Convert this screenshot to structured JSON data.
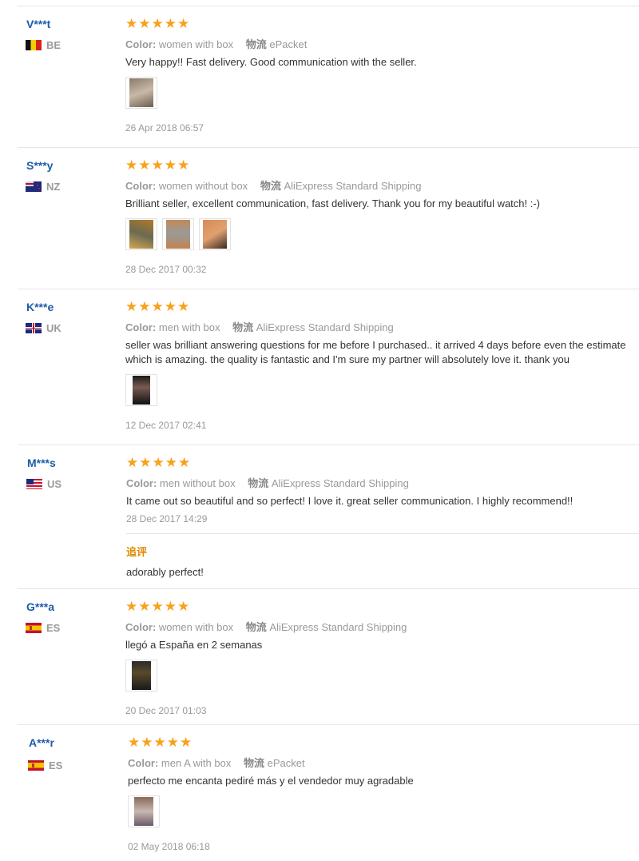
{
  "labels": {
    "color": "Color:",
    "shipping": "物流",
    "followup": "追评"
  },
  "reviews": [
    {
      "user": "V***t",
      "country": "BE",
      "stars": 5,
      "color": "women with box",
      "shipping": "ePacket",
      "text": [
        "Very happy!! Fast delivery. Good communication with the seller."
      ],
      "photos": 1,
      "date": "26 Apr 2018 06:57"
    },
    {
      "user": "S***y",
      "country": "NZ",
      "stars": 5,
      "color": "women without box",
      "shipping": "AliExpress Standard Shipping",
      "text": [
        "Brilliant seller, excellent communication, fast delivery. Thank you for my beautiful watch! :-)"
      ],
      "photos": 3,
      "date": "28 Dec 2017 00:32"
    },
    {
      "user": "K***e",
      "country": "UK",
      "stars": 5,
      "color": "men with box",
      "shipping": "AliExpress Standard Shipping",
      "text": [
        "seller was brilliant answering questions for me before I purchased.. it arrived 4 days before even the estimate",
        "which is amazing. the quality is fantastic and I'm sure my partner will absolutely love it. thank you"
      ],
      "photos": 1,
      "date": "12 Dec 2017 02:41"
    },
    {
      "user": "M***s",
      "country": "US",
      "stars": 5,
      "color": "men without box",
      "shipping": "AliExpress Standard Shipping",
      "text": [
        "It came out so beautiful and so perfect! I love it. great seller communication. I highly recommend!!"
      ],
      "photos": 0,
      "date": "28 Dec 2017 14:29",
      "followup": "adorably perfect!"
    },
    {
      "user": "G***a",
      "country": "ES",
      "stars": 5,
      "color": "women with box",
      "shipping": "AliExpress Standard Shipping",
      "text": [
        "llegó a España en 2 semanas"
      ],
      "photos": 1,
      "date": "20 Dec 2017 01:03"
    },
    {
      "user": "A***r",
      "country": "ES",
      "stars": 5,
      "color": "men A with box",
      "shipping": "ePacket",
      "text": [
        "perfecto me encanta pediré más y el vendedor muy agradable"
      ],
      "photos": 1,
      "date": "02 May 2018 06:18"
    }
  ],
  "colors": {
    "username": "#1e5ca8",
    "star": "#f7a21b",
    "followup": "#e08a00",
    "muted": "#999999"
  }
}
